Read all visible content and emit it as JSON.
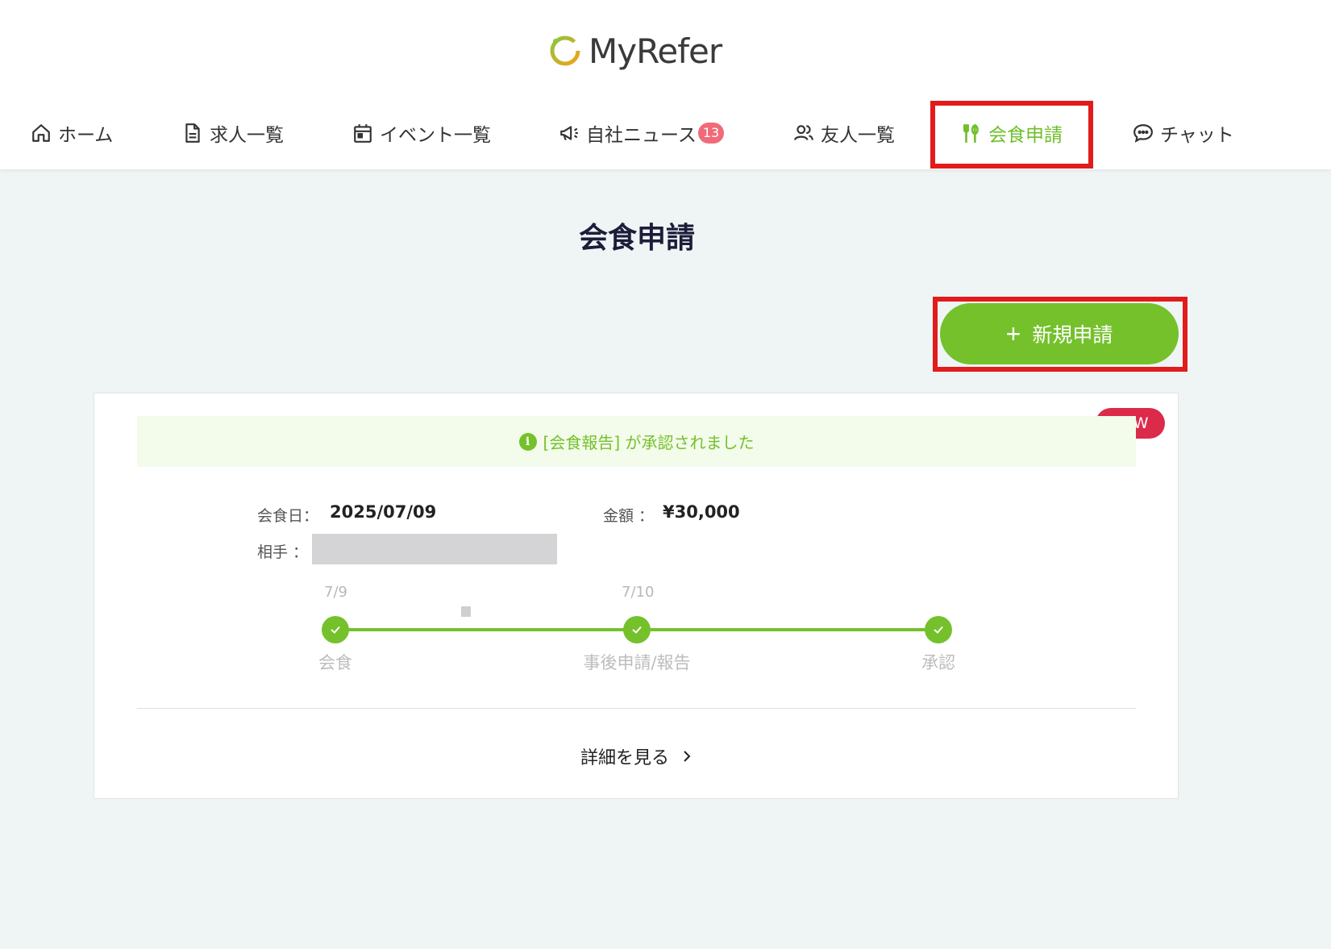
{
  "app": {
    "logo_text": "MyRefer"
  },
  "nav": {
    "items": [
      {
        "label": "ホーム",
        "icon": "home-icon"
      },
      {
        "label": "求人一覧",
        "icon": "document-icon"
      },
      {
        "label": "イベント一覧",
        "icon": "calendar-icon"
      },
      {
        "label": "自社ニュース",
        "icon": "megaphone-icon",
        "badge": "13"
      },
      {
        "label": "友人一覧",
        "icon": "users-icon"
      },
      {
        "label": "会食申請",
        "icon": "utensils-icon",
        "active": true
      },
      {
        "label": "チャット",
        "icon": "chat-icon"
      }
    ]
  },
  "page": {
    "title": "会食申請",
    "new_button_label": "新規申請",
    "new_button_icon": "plus-icon"
  },
  "card": {
    "badge": "NEW",
    "notice_text": "[会食報告] が承認されました",
    "dinner_date_label": "会食日：",
    "dinner_date_value": "2025/07/09",
    "amount_label": "金額 ：",
    "amount_value": "¥30,000",
    "partner_label": "相手 ：",
    "timeline": {
      "steps": [
        {
          "label": "会食",
          "date": "7/9",
          "done": true
        },
        {
          "label": "事後申請/報告",
          "date": "7/10",
          "done": true
        },
        {
          "label": "承認",
          "date": "",
          "done": true
        }
      ]
    },
    "detail_link_label": "詳細を見る"
  },
  "colors": {
    "accent": "#74c12c",
    "highlight": "#e21b1b",
    "new_badge": "#dc2a4a",
    "nav_badge": "#f16a7a"
  }
}
